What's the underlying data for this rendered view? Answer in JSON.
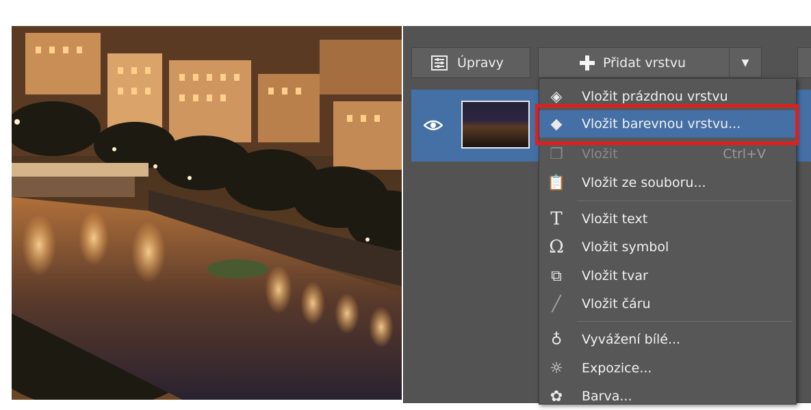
{
  "toolbar": {
    "upravy_label": "Úpravy",
    "upravy_icon": "adjustments-icon",
    "add_layer_label": "Přidat vrstvu",
    "add_layer_icon": "plus-icon",
    "dropdown_icon": "caret-down-icon"
  },
  "layer": {
    "visibility_icon": "eye-icon",
    "thumbnail": "night-city-thumbnail"
  },
  "menu": {
    "items": [
      {
        "label": "Vložit prázdnou vrstvu",
        "icon": "new-layer-icon",
        "enabled": true
      },
      {
        "label": "Vložit barevnou vrstvu...",
        "icon": "color-layer-icon",
        "enabled": true,
        "highlighted": true
      },
      {
        "label": "Vložit",
        "shortcut": "Ctrl+V",
        "icon": "paste-icon",
        "enabled": false
      },
      {
        "label": "Vložit ze souboru...",
        "icon": "clipboard-icon",
        "enabled": true
      },
      {
        "label": "Vložit text",
        "icon": "text-icon",
        "enabled": true
      },
      {
        "label": "Vložit symbol",
        "icon": "omega-icon",
        "enabled": true
      },
      {
        "label": "Vložit tvar",
        "icon": "shape-icon",
        "enabled": true
      },
      {
        "label": "Vložit čáru",
        "icon": "line-icon",
        "enabled": true
      },
      {
        "label": "Vyvážení bílé...",
        "icon": "bulb-icon",
        "enabled": true
      },
      {
        "label": "Expozice...",
        "icon": "sun-icon",
        "enabled": true
      },
      {
        "label": "Barva...",
        "icon": "palette-icon",
        "enabled": true
      }
    ]
  },
  "colors": {
    "panel_bg": "#535353",
    "selection": "#4570a5",
    "highlight_border": "#e11e1e"
  }
}
